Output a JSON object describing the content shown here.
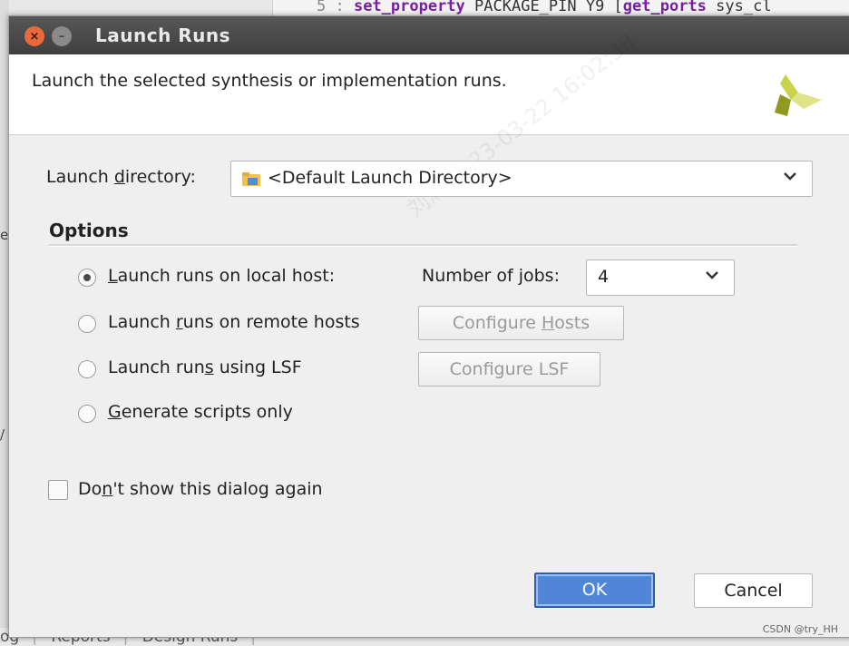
{
  "background": {
    "editor_line_number": "5 :",
    "editor_line_kw1": "set_property",
    "editor_line_mid": " PACKAGE_PIN Y9 [",
    "editor_line_kw2": "get_ports",
    "editor_line_tail": " sys_cl",
    "bottom_tabs": [
      "og",
      "Reports",
      "Design Runs"
    ],
    "left_chars": [
      "e",
      "/"
    ],
    "csdn_watermark": "CSDN @try_HH",
    "diagonal_watermark": "刘瀚  2023-03-22 16:02:38"
  },
  "dialog": {
    "title": "Launch Runs",
    "close_glyph": "×",
    "min_glyph": "–",
    "description": "Launch the selected synthesis or implementation runs.",
    "launch_directory": {
      "label_pre": "Launch ",
      "label_mnemonic": "d",
      "label_post": "irectory:",
      "value": "<Default Launch Directory>"
    },
    "options": {
      "title": "Options",
      "local_host": {
        "label_mnemonic": "L",
        "label_post": "aunch runs on local host:",
        "selected": true
      },
      "jobs": {
        "label_pre": "Number of ",
        "label_mnemonic": "j",
        "label_post": "obs:",
        "value": "4"
      },
      "remote_hosts": {
        "label_pre": "Launch ",
        "label_mnemonic": "r",
        "label_post": "uns on remote hosts",
        "button_pre": "Configure ",
        "button_mnemonic": "H",
        "button_post": "osts"
      },
      "lsf": {
        "label_pre": "Launch run",
        "label_mnemonic": "s",
        "label_post": " using LSF",
        "button": "Configure LSF"
      },
      "scripts": {
        "label_mnemonic": "G",
        "label_post": "enerate scripts only"
      }
    },
    "dont_show": {
      "label_pre": "Do",
      "label_mnemonic": "n",
      "label_post": "'t show this dialog again"
    },
    "ok_label": "OK",
    "cancel_label": "Cancel",
    "colors": {
      "accent": "#4f86d8",
      "titlebar": "#4a4a4a",
      "logo": "#b9c640"
    }
  }
}
